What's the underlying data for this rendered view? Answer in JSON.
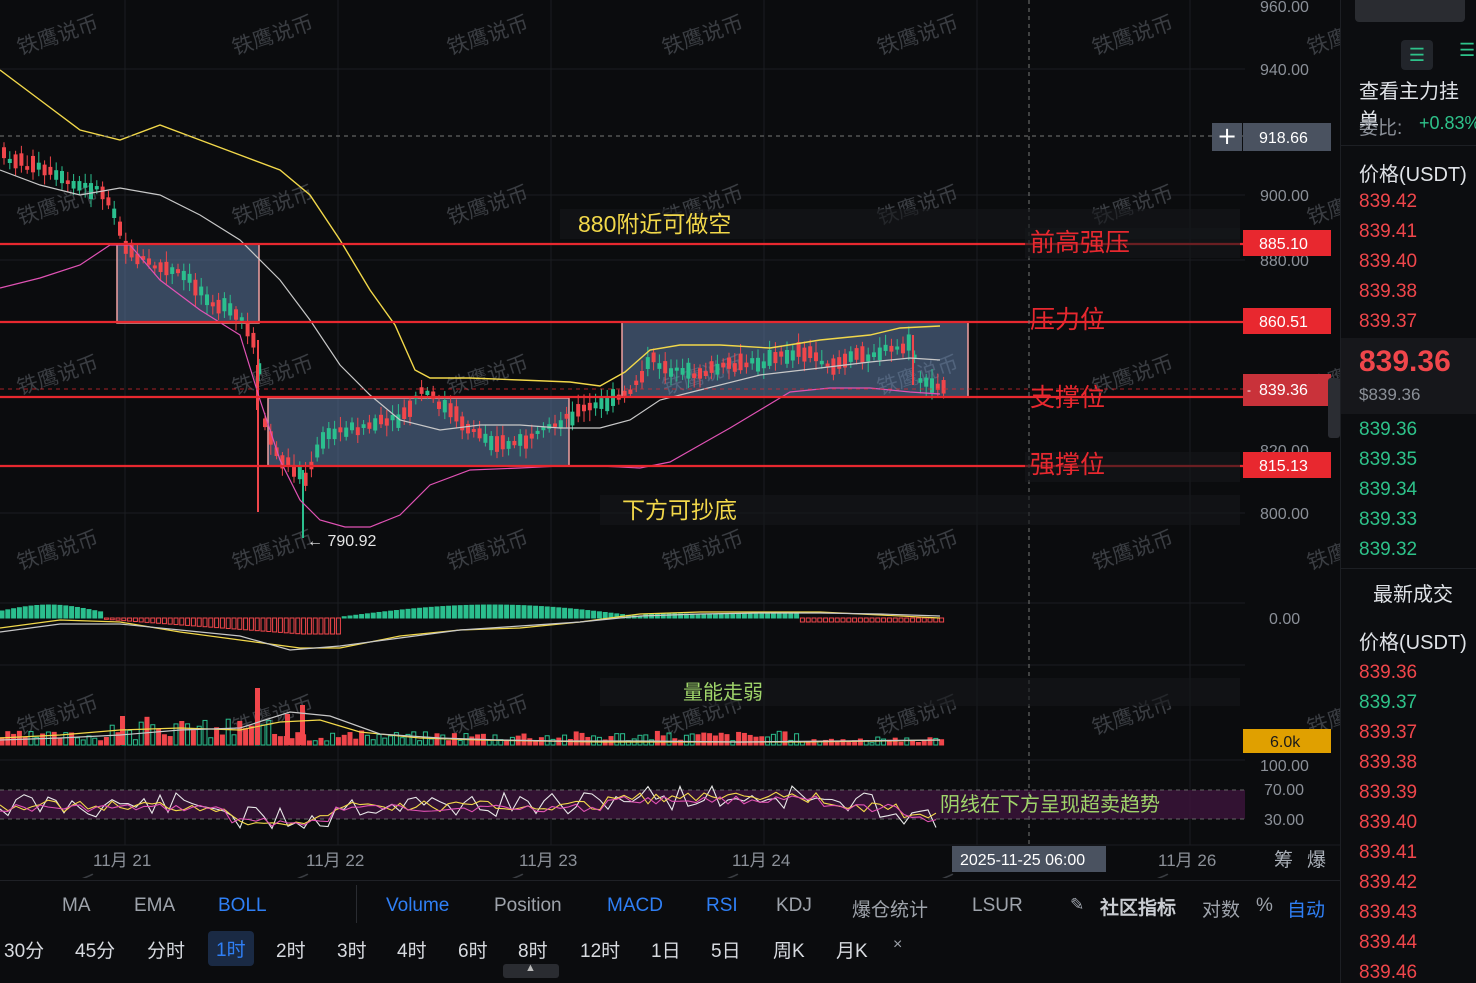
{
  "watermark": "铁鹰说币",
  "annotations": {
    "short_note": "880附近可做空",
    "prev_high": "前高强压",
    "resistance": "压力位",
    "support": "支撑位",
    "strong_support": "强撑位",
    "buy_dip": "下方可抄底",
    "volume_note": "量能走弱",
    "rsi_note": "阴线在下方呈现超卖趋势"
  },
  "price_axis": {
    "ticks": [
      "960.00",
      "940.00",
      "918.66",
      "900.00",
      "880.00",
      "820.00",
      "800.00"
    ],
    "level_labels": [
      "885.10",
      "860.51",
      "839.36",
      "815.13"
    ],
    "crosshair_price": "918.66",
    "current_price": "839.36",
    "macd_zero": "0.00",
    "volume_label": "6.0k",
    "rsi_ticks": [
      "100.00",
      "70.00",
      "30.00"
    ]
  },
  "low_marker": "← 790.92",
  "time_axis": {
    "labels": [
      "11月 21",
      "11月 22",
      "11月 23",
      "11月 24",
      "11月 26"
    ],
    "crosshair_time": "2025-11-25 06:00",
    "right_labels": [
      "筹",
      "爆"
    ]
  },
  "indicator_tabs": [
    "MA",
    "EMA",
    "BOLL",
    "Volume",
    "Position",
    "MACD",
    "RSI",
    "KDJ",
    "爆仓统计",
    "LSUR"
  ],
  "active_indicators": [
    "BOLL",
    "Volume",
    "MACD",
    "RSI"
  ],
  "toolbar_right": {
    "community": "社区指标",
    "log": "对数",
    "percent": "%",
    "auto": "自动"
  },
  "intervals": [
    "30分",
    "45分",
    "分时",
    "1时",
    "2时",
    "3时",
    "4时",
    "6时",
    "8时",
    "12时",
    "1日",
    "5日",
    "周K",
    "月K",
    "×"
  ],
  "selected_interval": "1时",
  "right_panel": {
    "top_label": "查看主力挂单",
    "ratio_label": "委比:",
    "ratio_value": "+0.83%",
    "price_header": "价格(USDT)",
    "asks": [
      "839.42",
      "839.41",
      "839.40",
      "839.38",
      "839.37"
    ],
    "last_price": "839.36",
    "last_price_usd": "$839.36",
    "bids": [
      "839.36",
      "839.35",
      "839.34",
      "839.33",
      "839.32"
    ],
    "trades_header": "最新成交",
    "trades_price_header": "价格(USDT)",
    "trades": [
      "839.36",
      "839.37",
      "839.37",
      "839.38",
      "839.39",
      "839.40",
      "839.41",
      "839.42",
      "839.43",
      "839.44",
      "839.46"
    ],
    "trade_colors": [
      "red",
      "green",
      "red",
      "red",
      "red",
      "red",
      "red",
      "red",
      "red",
      "red",
      "red"
    ]
  },
  "colors": {
    "background": "#0b0c0e",
    "red_line": "#e8282f",
    "bull": "#2bbf8e",
    "bear": "#f0464b",
    "yellow": "#f2d84a",
    "pink": "#e052b4",
    "white_line": "#c8c8c8",
    "accent_blue": "#2f7ff5",
    "volume_tag": "#e0a000"
  }
}
